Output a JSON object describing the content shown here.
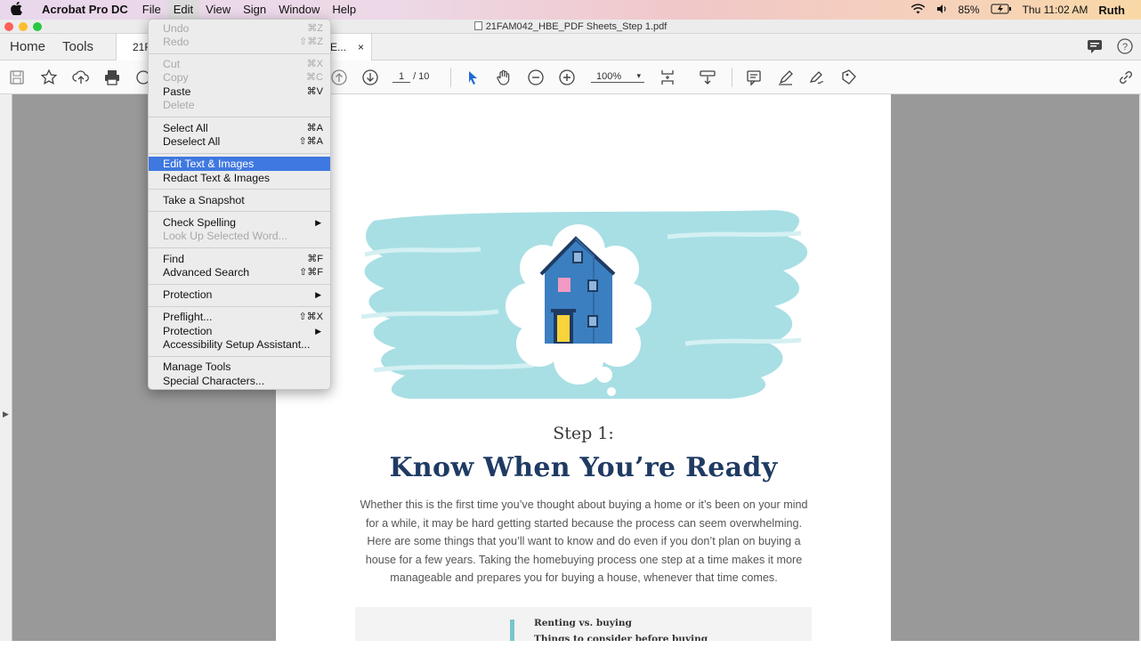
{
  "menubar": {
    "app_name": "Acrobat Pro DC",
    "items": [
      "File",
      "Edit",
      "View",
      "Sign",
      "Window",
      "Help"
    ],
    "battery": "85%",
    "clock": "Thu 11:02 AM",
    "user": "Ruth"
  },
  "window": {
    "title": "21FAM042_HBE_PDF Sheets_Step 1.pdf"
  },
  "tabs": {
    "home": "Home",
    "tools": "Tools",
    "doc_tab": "21FAM042_HBE...",
    "doc_tab_left": "21F",
    "doc_tab_right": "E...",
    "close": "×"
  },
  "toolbar": {
    "page_current": "1",
    "page_total": "/ 10",
    "zoom": "100%"
  },
  "edit_menu": {
    "items": [
      {
        "label": "Undo",
        "shortcut": "⌘Z",
        "disabled": true
      },
      {
        "label": "Redo",
        "shortcut": "⇧⌘Z",
        "disabled": true
      },
      {
        "label": "Cut",
        "shortcut": "⌘X",
        "disabled": true
      },
      {
        "label": "Copy",
        "shortcut": "⌘C",
        "disabled": true
      },
      {
        "label": "Paste",
        "shortcut": "⌘V",
        "disabled": false
      },
      {
        "label": "Delete",
        "shortcut": "",
        "disabled": true
      },
      {
        "label": "Select All",
        "shortcut": "⌘A",
        "disabled": false
      },
      {
        "label": "Deselect All",
        "shortcut": "⇧⌘A",
        "disabled": false
      },
      {
        "label": "Edit Text & Images",
        "shortcut": "",
        "disabled": false,
        "highlighted": true
      },
      {
        "label": "Redact Text & Images",
        "shortcut": "",
        "disabled": false
      },
      {
        "label": "Take a Snapshot",
        "shortcut": "",
        "disabled": false
      },
      {
        "label": "Check Spelling",
        "shortcut": "",
        "submenu": true,
        "disabled": false
      },
      {
        "label": "Look Up Selected Word...",
        "shortcut": "",
        "disabled": true
      },
      {
        "label": "Find",
        "shortcut": "⌘F",
        "disabled": false
      },
      {
        "label": "Advanced Search",
        "shortcut": "⇧⌘F",
        "disabled": false
      },
      {
        "label": "Protection",
        "shortcut": "",
        "submenu": true,
        "disabled": false
      },
      {
        "label": "Preflight...",
        "shortcut": "⇧⌘X",
        "disabled": false
      },
      {
        "label": "Protection",
        "shortcut": "",
        "submenu": true,
        "disabled": false
      },
      {
        "label": "Accessibility Setup Assistant...",
        "shortcut": "",
        "disabled": false
      },
      {
        "label": "Manage Tools",
        "shortcut": "",
        "disabled": false
      },
      {
        "label": "Special Characters...",
        "shortcut": "",
        "disabled": false
      }
    ]
  },
  "document": {
    "step": "Step 1:",
    "headline": "Know When You’re Ready",
    "body_lines": [
      "Whether this is the first time you’ve thought about buying a home or it’s been on your mind",
      "for a while, it may be hard getting started because the process can seem overwhelming.",
      "Here are some things that you’ll want to know and do even if you don’t plan on buying a",
      "house for a few years. Taking the homebuying process one step at a time makes it more",
      "manageable and prepares you for buying a house, whenever that time comes."
    ],
    "callout_1": "Renting vs. buying",
    "callout_2": "Things to consider before buying"
  },
  "colors": {
    "accent": "#3f78e0",
    "headline": "#1f3b63",
    "house_blue": "#3b7fc0",
    "brush_teal": "#a8dfe4"
  }
}
